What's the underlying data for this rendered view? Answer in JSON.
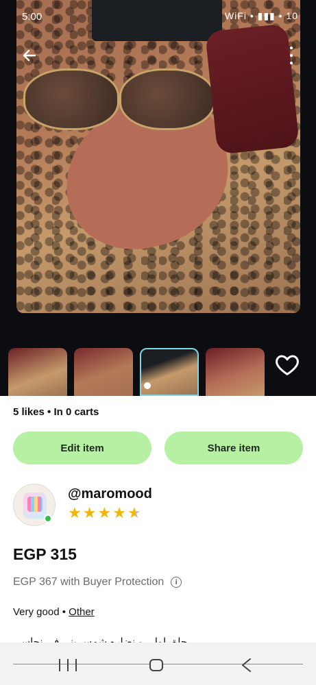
{
  "status_bar": {
    "time": "5:00",
    "icons": "WiFi • ▮▮▮ • 10"
  },
  "photo": {
    "alt": "Sunglasses with case on leopard fabric"
  },
  "thumbnails": [
    {
      "name": "thumb-1"
    },
    {
      "name": "thumb-2"
    },
    {
      "name": "thumb-3",
      "selected": true
    },
    {
      "name": "thumb-4"
    }
  ],
  "stats": {
    "text": "5 likes • In 0 carts"
  },
  "actions": {
    "edit_label": "Edit item",
    "share_label": "Share item"
  },
  "seller": {
    "username": "@maromood",
    "rating": 4.5,
    "online": true
  },
  "listing": {
    "price": "EGP 315",
    "protection": "EGP 367 with Buyer Protection",
    "condition": "Very good",
    "separator": " • ",
    "category": "Other",
    "description": "حلق لولي و نضاره شمس بني في نحاسي"
  },
  "colors": {
    "accent_button": "#b6f0a3",
    "star": "#f2b705",
    "online": "#2fbf4a"
  },
  "icons": [
    "back-arrow-icon",
    "more-vertical-icon",
    "heart-icon",
    "info-icon",
    "nav-recents-icon",
    "nav-home-icon",
    "nav-back-icon"
  ]
}
